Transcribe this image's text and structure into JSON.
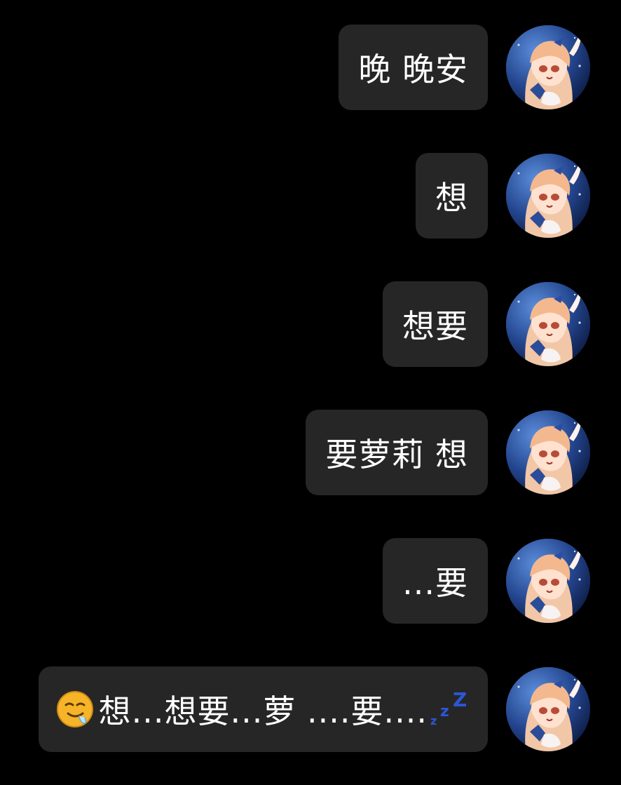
{
  "messages": [
    {
      "text": "晚 晚安",
      "avatar_icon": "anime-girl-avatar-icon"
    },
    {
      "text": "想",
      "avatar_icon": "anime-girl-avatar-icon"
    },
    {
      "text": "想要",
      "avatar_icon": "anime-girl-avatar-icon"
    },
    {
      "text": "要萝莉 想",
      "avatar_icon": "anime-girl-avatar-icon"
    },
    {
      "text": "...要",
      "avatar_icon": "anime-girl-avatar-icon"
    },
    {
      "text": "想...想要...萝 ....要....",
      "leading_icon": "drooling-face-emoji",
      "trailing_icon": "zzz-sleeping-emoji",
      "avatar_icon": "anime-girl-avatar-icon"
    }
  ],
  "colors": {
    "background": "#000000",
    "bubble": "#262626",
    "text": "#ffffff",
    "zzz": "#2b57d6"
  }
}
